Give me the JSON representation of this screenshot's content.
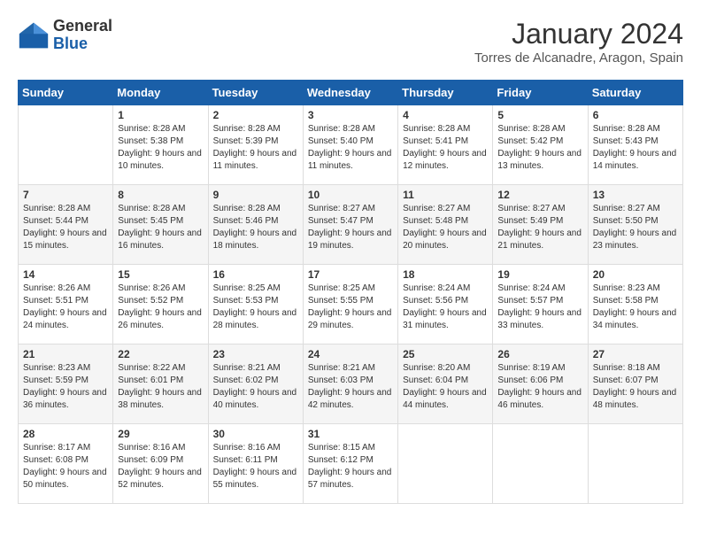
{
  "header": {
    "logo_general": "General",
    "logo_blue": "Blue",
    "month_title": "January 2024",
    "location": "Torres de Alcanadre, Aragon, Spain"
  },
  "columns": [
    "Sunday",
    "Monday",
    "Tuesday",
    "Wednesday",
    "Thursday",
    "Friday",
    "Saturday"
  ],
  "weeks": [
    [
      {
        "num": "",
        "sunrise": "",
        "sunset": "",
        "daylight": ""
      },
      {
        "num": "1",
        "sunrise": "Sunrise: 8:28 AM",
        "sunset": "Sunset: 5:38 PM",
        "daylight": "Daylight: 9 hours and 10 minutes."
      },
      {
        "num": "2",
        "sunrise": "Sunrise: 8:28 AM",
        "sunset": "Sunset: 5:39 PM",
        "daylight": "Daylight: 9 hours and 11 minutes."
      },
      {
        "num": "3",
        "sunrise": "Sunrise: 8:28 AM",
        "sunset": "Sunset: 5:40 PM",
        "daylight": "Daylight: 9 hours and 11 minutes."
      },
      {
        "num": "4",
        "sunrise": "Sunrise: 8:28 AM",
        "sunset": "Sunset: 5:41 PM",
        "daylight": "Daylight: 9 hours and 12 minutes."
      },
      {
        "num": "5",
        "sunrise": "Sunrise: 8:28 AM",
        "sunset": "Sunset: 5:42 PM",
        "daylight": "Daylight: 9 hours and 13 minutes."
      },
      {
        "num": "6",
        "sunrise": "Sunrise: 8:28 AM",
        "sunset": "Sunset: 5:43 PM",
        "daylight": "Daylight: 9 hours and 14 minutes."
      }
    ],
    [
      {
        "num": "7",
        "sunrise": "Sunrise: 8:28 AM",
        "sunset": "Sunset: 5:44 PM",
        "daylight": "Daylight: 9 hours and 15 minutes."
      },
      {
        "num": "8",
        "sunrise": "Sunrise: 8:28 AM",
        "sunset": "Sunset: 5:45 PM",
        "daylight": "Daylight: 9 hours and 16 minutes."
      },
      {
        "num": "9",
        "sunrise": "Sunrise: 8:28 AM",
        "sunset": "Sunset: 5:46 PM",
        "daylight": "Daylight: 9 hours and 18 minutes."
      },
      {
        "num": "10",
        "sunrise": "Sunrise: 8:27 AM",
        "sunset": "Sunset: 5:47 PM",
        "daylight": "Daylight: 9 hours and 19 minutes."
      },
      {
        "num": "11",
        "sunrise": "Sunrise: 8:27 AM",
        "sunset": "Sunset: 5:48 PM",
        "daylight": "Daylight: 9 hours and 20 minutes."
      },
      {
        "num": "12",
        "sunrise": "Sunrise: 8:27 AM",
        "sunset": "Sunset: 5:49 PM",
        "daylight": "Daylight: 9 hours and 21 minutes."
      },
      {
        "num": "13",
        "sunrise": "Sunrise: 8:27 AM",
        "sunset": "Sunset: 5:50 PM",
        "daylight": "Daylight: 9 hours and 23 minutes."
      }
    ],
    [
      {
        "num": "14",
        "sunrise": "Sunrise: 8:26 AM",
        "sunset": "Sunset: 5:51 PM",
        "daylight": "Daylight: 9 hours and 24 minutes."
      },
      {
        "num": "15",
        "sunrise": "Sunrise: 8:26 AM",
        "sunset": "Sunset: 5:52 PM",
        "daylight": "Daylight: 9 hours and 26 minutes."
      },
      {
        "num": "16",
        "sunrise": "Sunrise: 8:25 AM",
        "sunset": "Sunset: 5:53 PM",
        "daylight": "Daylight: 9 hours and 28 minutes."
      },
      {
        "num": "17",
        "sunrise": "Sunrise: 8:25 AM",
        "sunset": "Sunset: 5:55 PM",
        "daylight": "Daylight: 9 hours and 29 minutes."
      },
      {
        "num": "18",
        "sunrise": "Sunrise: 8:24 AM",
        "sunset": "Sunset: 5:56 PM",
        "daylight": "Daylight: 9 hours and 31 minutes."
      },
      {
        "num": "19",
        "sunrise": "Sunrise: 8:24 AM",
        "sunset": "Sunset: 5:57 PM",
        "daylight": "Daylight: 9 hours and 33 minutes."
      },
      {
        "num": "20",
        "sunrise": "Sunrise: 8:23 AM",
        "sunset": "Sunset: 5:58 PM",
        "daylight": "Daylight: 9 hours and 34 minutes."
      }
    ],
    [
      {
        "num": "21",
        "sunrise": "Sunrise: 8:23 AM",
        "sunset": "Sunset: 5:59 PM",
        "daylight": "Daylight: 9 hours and 36 minutes."
      },
      {
        "num": "22",
        "sunrise": "Sunrise: 8:22 AM",
        "sunset": "Sunset: 6:01 PM",
        "daylight": "Daylight: 9 hours and 38 minutes."
      },
      {
        "num": "23",
        "sunrise": "Sunrise: 8:21 AM",
        "sunset": "Sunset: 6:02 PM",
        "daylight": "Daylight: 9 hours and 40 minutes."
      },
      {
        "num": "24",
        "sunrise": "Sunrise: 8:21 AM",
        "sunset": "Sunset: 6:03 PM",
        "daylight": "Daylight: 9 hours and 42 minutes."
      },
      {
        "num": "25",
        "sunrise": "Sunrise: 8:20 AM",
        "sunset": "Sunset: 6:04 PM",
        "daylight": "Daylight: 9 hours and 44 minutes."
      },
      {
        "num": "26",
        "sunrise": "Sunrise: 8:19 AM",
        "sunset": "Sunset: 6:06 PM",
        "daylight": "Daylight: 9 hours and 46 minutes."
      },
      {
        "num": "27",
        "sunrise": "Sunrise: 8:18 AM",
        "sunset": "Sunset: 6:07 PM",
        "daylight": "Daylight: 9 hours and 48 minutes."
      }
    ],
    [
      {
        "num": "28",
        "sunrise": "Sunrise: 8:17 AM",
        "sunset": "Sunset: 6:08 PM",
        "daylight": "Daylight: 9 hours and 50 minutes."
      },
      {
        "num": "29",
        "sunrise": "Sunrise: 8:16 AM",
        "sunset": "Sunset: 6:09 PM",
        "daylight": "Daylight: 9 hours and 52 minutes."
      },
      {
        "num": "30",
        "sunrise": "Sunrise: 8:16 AM",
        "sunset": "Sunset: 6:11 PM",
        "daylight": "Daylight: 9 hours and 55 minutes."
      },
      {
        "num": "31",
        "sunrise": "Sunrise: 8:15 AM",
        "sunset": "Sunset: 6:12 PM",
        "daylight": "Daylight: 9 hours and 57 minutes."
      },
      {
        "num": "",
        "sunrise": "",
        "sunset": "",
        "daylight": ""
      },
      {
        "num": "",
        "sunrise": "",
        "sunset": "",
        "daylight": ""
      },
      {
        "num": "",
        "sunrise": "",
        "sunset": "",
        "daylight": ""
      }
    ]
  ]
}
